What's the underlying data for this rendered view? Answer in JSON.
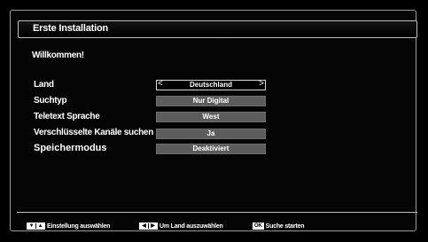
{
  "dialog": {
    "title": "Erste Installation",
    "welcome": "Willkommen!"
  },
  "settings": [
    {
      "label": "Land",
      "value": "Deutschland",
      "selected": true
    },
    {
      "label": "Suchtyp",
      "value": "Nur Digital",
      "selected": false
    },
    {
      "label": "Teletext Sprache",
      "value": "West",
      "selected": false
    },
    {
      "label": "Verschlüsselte Kanäle suchen",
      "value": "Ja",
      "selected": false
    },
    {
      "label": "Speichermodus",
      "value": "Deaktiviert",
      "selected": false
    }
  ],
  "arrows": {
    "left": "<",
    "right": ">"
  },
  "footer": {
    "hint_select": {
      "keys": [
        "▼",
        "▲"
      ],
      "label": "Einstellung auswählen"
    },
    "hint_country": {
      "keys": [
        "◀",
        "▶"
      ],
      "label": "Um Land auszuwählen"
    },
    "hint_search": {
      "key": "OK",
      "label": "Suche starten"
    }
  }
}
